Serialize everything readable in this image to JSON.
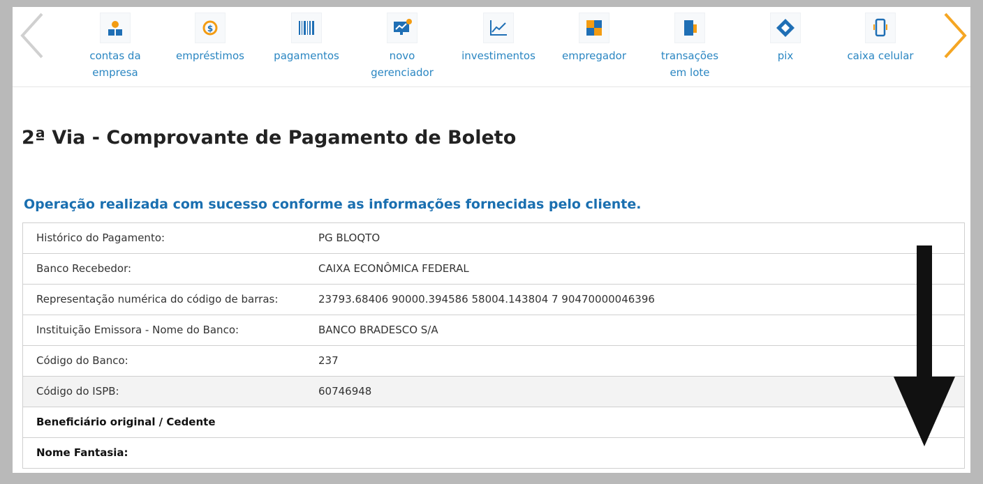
{
  "nav": {
    "items": [
      {
        "label": "contas da\nempresa",
        "icon": "people-icon"
      },
      {
        "label": "empréstimos",
        "icon": "coin-icon"
      },
      {
        "label": "pagamentos",
        "icon": "barcode-icon"
      },
      {
        "label": "novo\ngerenciador",
        "icon": "monitor-chart-icon"
      },
      {
        "label": "investimentos",
        "icon": "line-chart-icon"
      },
      {
        "label": "empregador",
        "icon": "puzzle-icon"
      },
      {
        "label": "transações\nem lote",
        "icon": "document-batch-icon"
      },
      {
        "label": "pix",
        "icon": "pix-icon"
      },
      {
        "label": "caixa celular",
        "icon": "phone-icon"
      }
    ]
  },
  "page": {
    "title": "2ª Via - Comprovante de Pagamento de Boleto",
    "success_message": "Operação realizada com sucesso conforme as informações fornecidas pelo cliente."
  },
  "details": {
    "rows": [
      {
        "label": "Histórico do Pagamento:",
        "value": "PG BLOQTO"
      },
      {
        "label": "Banco Recebedor:",
        "value": "CAIXA ECONÔMICA FEDERAL"
      },
      {
        "label": "Representação numérica do código de barras:",
        "value": "23793.68406 90000.394586 58004.143804 7 90470000046396"
      },
      {
        "label": "Instituição Emissora - Nome do Banco:",
        "value": "BANCO BRADESCO S/A"
      },
      {
        "label": "Código do Banco:",
        "value": "237"
      },
      {
        "label": "Código do ISPB:",
        "value": "60746948"
      },
      {
        "label": "Beneficiário original / Cedente",
        "value": ""
      },
      {
        "label": "Nome Fantasia:",
        "value": ""
      }
    ]
  },
  "colors": {
    "accent_blue": "#2a86c2",
    "title_blue": "#1a6fb0",
    "arrow_orange": "#f5a623",
    "icon_orange": "#f39c12"
  }
}
